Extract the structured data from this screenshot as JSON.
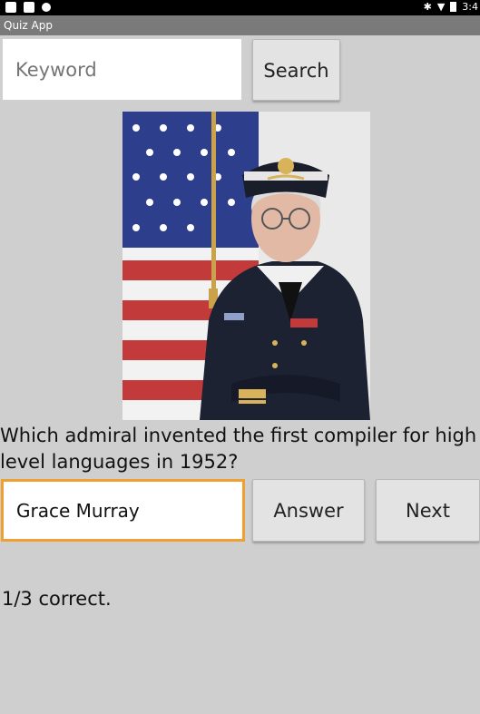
{
  "status_bar": {
    "time": "3:4"
  },
  "app": {
    "title": "Quiz App"
  },
  "search": {
    "placeholder": "Keyword",
    "button_label": "Search"
  },
  "quiz": {
    "question": "Which admiral invented the first compiler for high level languages in 1952?",
    "answer_value": "Grace Murray",
    "answer_button_label": "Answer",
    "next_button_label": "Next",
    "score": "1/3 correct."
  },
  "colors": {
    "focus_border": "#f0a030",
    "background": "#cfcfcf"
  }
}
